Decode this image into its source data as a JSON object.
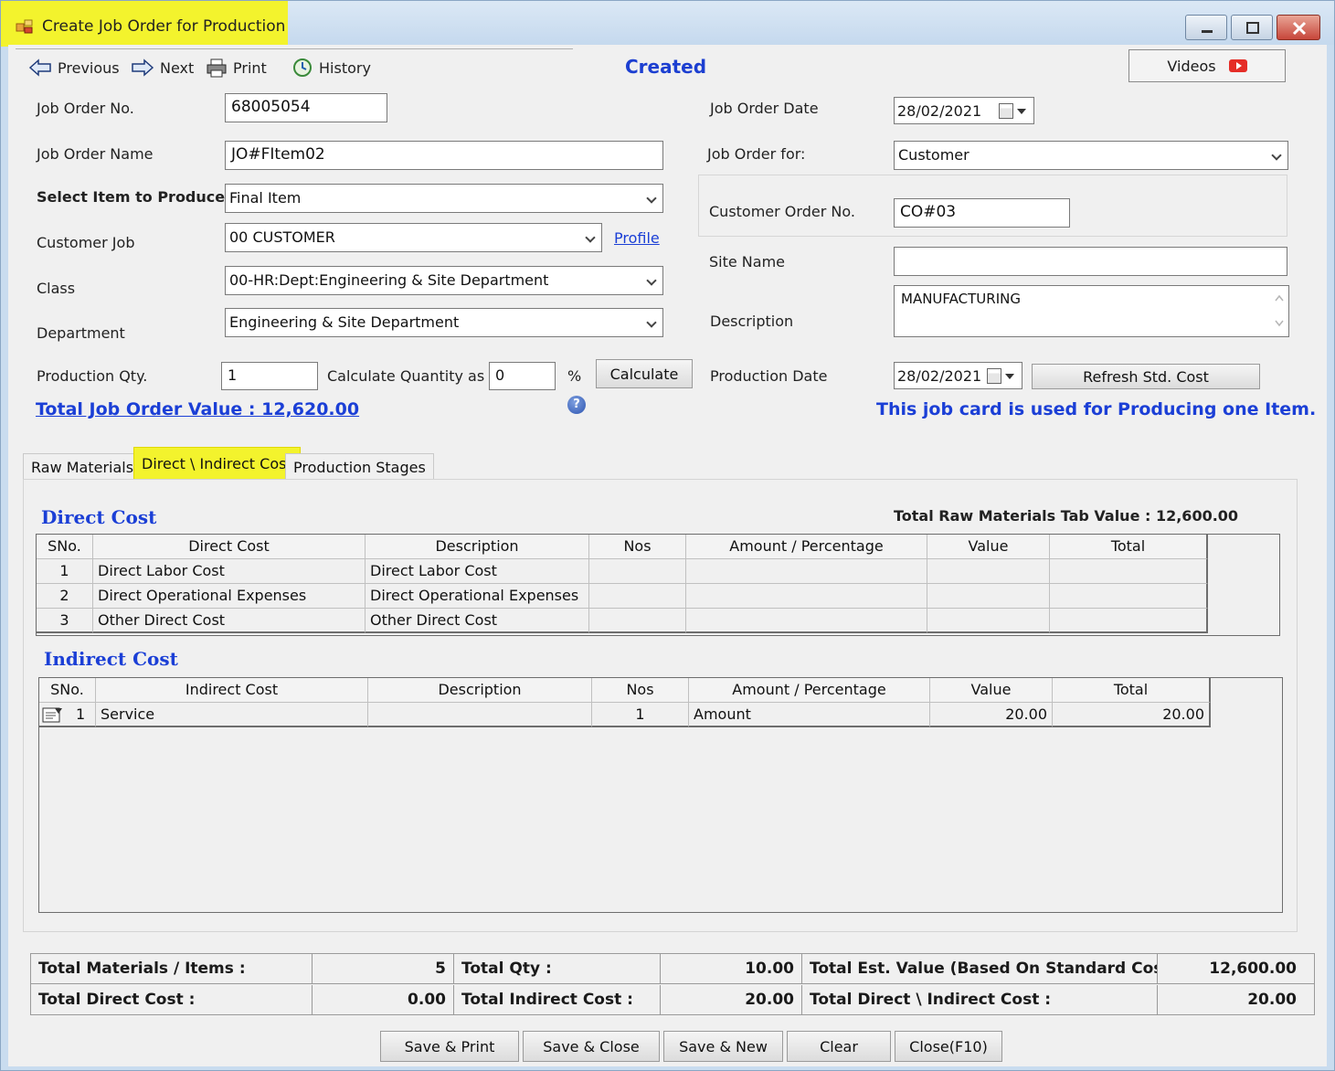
{
  "window": {
    "title": "Create Job Order for Production"
  },
  "toolbar": {
    "previous": "Previous",
    "next": "Next",
    "print": "Print",
    "history": "History",
    "status": "Created",
    "videos": "Videos"
  },
  "form": {
    "job_order_no_label": "Job Order No.",
    "job_order_no": "68005054",
    "job_order_name_label": "Job Order Name",
    "job_order_name": "JO#FItem02",
    "select_item_label": "Select Item to Produce",
    "select_item": "Final Item",
    "customer_job_label": "Customer Job",
    "customer_job": "00 CUSTOMER",
    "profile_link": "Profile",
    "class_label": "Class",
    "class": "00-HR:Dept:Engineering & Site Department",
    "department_label": "Department",
    "department": "Engineering & Site Department",
    "production_qty_label": "Production Qty.",
    "production_qty": "1",
    "calc_qty_label": "Calculate Quantity as",
    "calc_qty": "0",
    "percent": "%",
    "calculate_btn": "Calculate",
    "total_value": "Total Job Order Value : 12,620.00",
    "job_order_date_label": "Job Order Date",
    "job_order_date": "28/02/2021",
    "job_order_for_label": "Job Order for:",
    "job_order_for": "Customer",
    "customer_order_no_label": "Customer Order No.",
    "customer_order_no": "CO#03",
    "site_name_label": "Site Name",
    "site_name": "",
    "description_label": "Description",
    "description": "MANUFACTURING",
    "production_date_label": "Production Date",
    "production_date": "28/02/2021",
    "refresh_btn": "Refresh Std. Cost",
    "info_message": "This job card is used for Producing one Item."
  },
  "tabs": [
    "Raw Materials",
    "Direct \\ Indirect Cost",
    "Production Stages"
  ],
  "direct_cost": {
    "title": "Direct Cost",
    "raw_materials_total": "Total Raw Materials Tab Value : 12,600.00",
    "columns": [
      "SNo.",
      "Direct Cost",
      "Description",
      "Nos",
      "Amount / Percentage",
      "Value",
      "Total"
    ],
    "rows": [
      [
        "1",
        "Direct Labor Cost",
        "Direct Labor Cost",
        "",
        "",
        "",
        ""
      ],
      [
        "2",
        "Direct Operational Expenses",
        "Direct Operational Expenses",
        "",
        "",
        "",
        ""
      ],
      [
        "3",
        "Other Direct Cost",
        "Other Direct Cost",
        "",
        "",
        "",
        ""
      ]
    ]
  },
  "indirect_cost": {
    "title": "Indirect Cost",
    "columns": [
      "SNo.",
      "Indirect Cost",
      "Description",
      "Nos",
      "Amount / Percentage",
      "Value",
      "Total"
    ],
    "rows": [
      [
        "1",
        "Service",
        "",
        "1",
        "Amount",
        "20.00",
        "20.00"
      ]
    ]
  },
  "summary": {
    "total_materials_label": "Total Materials / Items :",
    "total_materials": "5",
    "total_qty_label": "Total Qty :",
    "total_qty": "10.00",
    "total_est_label": "Total Est. Value  (Based On Standard Cost) :",
    "total_est": "12,600.00",
    "total_direct_label": "Total Direct Cost :",
    "total_direct": "0.00",
    "total_indirect_label": "Total Indirect Cost :",
    "total_indirect": "20.00",
    "total_di_label": "Total Direct \\ Indirect Cost  :",
    "total_di": "20.00"
  },
  "buttons": {
    "save_print": "Save & Print",
    "save_close": "Save & Close",
    "save_new": "Save & New",
    "clear": "Clear",
    "close": "Close(F10)"
  },
  "colors": {
    "accent_blue": "#1b3fd6",
    "highlight_yellow": "#f3f32d",
    "window_frame": "#c9dcef"
  }
}
